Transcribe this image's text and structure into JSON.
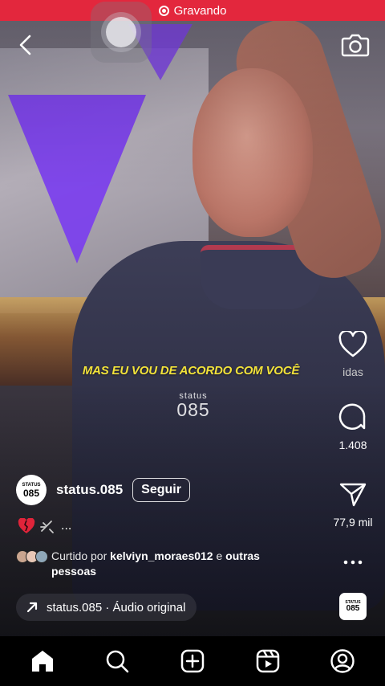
{
  "status_bar": {
    "recording_label": "Gravando"
  },
  "video": {
    "caption": "MAS EU VOU DE ACORDO COM VOCÊ",
    "watermark_small": "status",
    "watermark_big": "085"
  },
  "actions": {
    "likes_count": "idas",
    "comments_count": "1.408",
    "shares_count": "77,9 mil"
  },
  "post": {
    "avatar_line1": "STATUS",
    "avatar_line2": "085",
    "username": "status.085",
    "follow_label": "Seguir",
    "description_suffix": "...",
    "liked_prefix": "Curtido por",
    "liked_user": "kelviyn_moraes012",
    "liked_conj": "e",
    "liked_others": "outras",
    "liked_others2": "pessoas"
  },
  "audio": {
    "label": "status.085 · Áudio original",
    "thumb_line1": "STATUS",
    "thumb_line2": "085"
  },
  "colors": {
    "recording_bar": "#e3273d",
    "caption": "#f3e33a"
  },
  "icons": {
    "back": "chevron-left-icon",
    "camera": "camera-icon",
    "like": "heart-icon",
    "comment": "comment-icon",
    "share": "send-icon",
    "more": "more-icon",
    "home": "home-icon",
    "search": "search-icon",
    "create": "plus-square-icon",
    "reels": "reels-icon",
    "profile": "profile-icon"
  }
}
